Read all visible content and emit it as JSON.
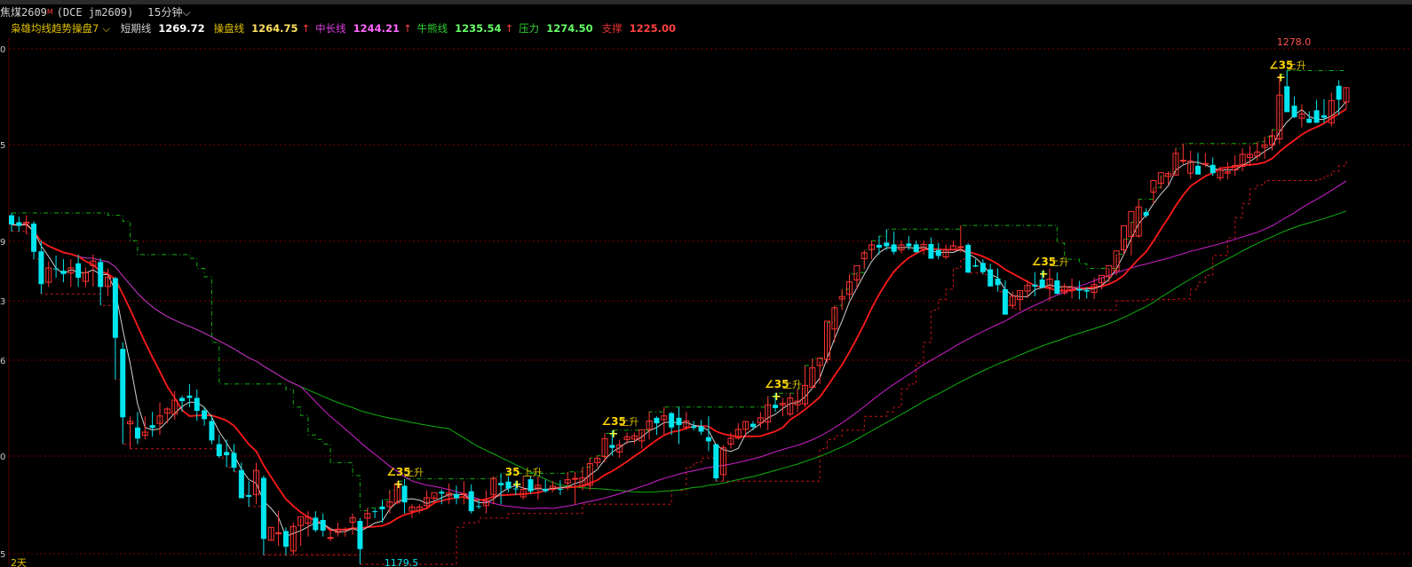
{
  "header": {
    "symbol": "焦煤2609",
    "badge": "M",
    "exchange": "(DCE  jm2609)",
    "period": "15分钟",
    "period_arrow": "⌵"
  },
  "indicator": {
    "name": "枭雄均线趋势操盘7",
    "arrow": "⌵",
    "items": [
      {
        "label": "短期线",
        "value": "1269.72",
        "label_color": "#d0d0d0",
        "value_color": "#ffffff",
        "arrow": ""
      },
      {
        "label": "操盘线",
        "value": "1264.75",
        "label_color": "#e0c000",
        "value_color": "#ffe060",
        "arrow": "↑"
      },
      {
        "label": "中长线",
        "value": "1244.21",
        "label_color": "#e040e0",
        "value_color": "#ff66ff",
        "arrow": "↑"
      },
      {
        "label": "牛熊线",
        "value": "1235.54",
        "label_color": "#30d030",
        "value_color": "#66ff66",
        "arrow": "↑"
      },
      {
        "label": "压力",
        "value": "1274.50",
        "label_color": "#30d030",
        "value_color": "#66ff66",
        "arrow": ""
      },
      {
        "label": "支撑",
        "value": "1225.00",
        "label_color": "#e03030",
        "value_color": "#ff4040",
        "arrow": ""
      }
    ]
  },
  "y_axis_labels": [
    "0",
    "5",
    "9",
    "3",
    "6",
    "0",
    "5"
  ],
  "annotations": {
    "high_value": "1278.0",
    "low_value": "1179.5",
    "bottom_left": "2天"
  },
  "signals": [
    {
      "prefix": "∠",
      "text": "35",
      "suffix": "上升"
    },
    {
      "prefix": "",
      "text": "35",
      "suffix": "上升"
    },
    {
      "prefix": "∠",
      "text": "35",
      "suffix": "上升"
    },
    {
      "prefix": "∠",
      "text": "35",
      "suffix": "上升"
    },
    {
      "prefix": "∠",
      "text": "35",
      "suffix": "上升"
    },
    {
      "prefix": "∠",
      "text": "35",
      "suffix": "上升"
    }
  ],
  "colors": {
    "background": "#000000",
    "bull": "#ff3232",
    "bear": "#00e5ee",
    "grid": "#7a0000",
    "short_line": "#d0d0d0",
    "trade_line": "#ff1a1a",
    "blue_line": "#1e28ff",
    "mid_line": "#d020d0",
    "bull_bear_line": "#10b010",
    "resistance": "#10b010",
    "support": "#c81414"
  },
  "chart_data": {
    "type": "candlestick",
    "price_range": [
      1172,
      1286
    ],
    "visible_levels": [
      1278.0,
      1179.5
    ],
    "ohlc_estimated": [
      [
        1247.5,
        1248,
        1244,
        1245.5
      ],
      [
        1246,
        1247.2,
        1244,
        1245.2
      ],
      [
        1245.7,
        1247.5,
        1243.5,
        1246
      ],
      [
        1245.7,
        1246.2,
        1238,
        1239.6
      ],
      [
        1239.7,
        1242,
        1230.5,
        1232.6
      ],
      [
        1233,
        1237.5,
        1232,
        1236.1
      ],
      [
        1236,
        1238.8,
        1234,
        1235.9
      ],
      [
        1235.5,
        1238,
        1233,
        1234.8
      ],
      [
        1235,
        1238,
        1232,
        1236.1
      ],
      [
        1237.1,
        1239,
        1232,
        1234
      ],
      [
        1233.2,
        1236.2,
        1232,
        1235.1
      ],
      [
        1236.6,
        1239,
        1232,
        1237.6
      ],
      [
        1237.4,
        1238.2,
        1228,
        1232
      ],
      [
        1232.1,
        1236,
        1230,
        1234.1
      ],
      [
        1233.9,
        1234.2,
        1212,
        1221
      ],
      [
        1218.6,
        1220,
        1198,
        1203.8
      ],
      [
        1202.4,
        1204,
        1197,
        1202.9
      ],
      [
        1201.6,
        1205,
        1198,
        1199.2
      ],
      [
        1199.9,
        1204,
        1199,
        1200.6
      ],
      [
        1202.1,
        1205,
        1199.6,
        1201.5
      ],
      [
        1202.5,
        1207,
        1200,
        1204.1
      ],
      [
        1204.7,
        1206,
        1202.5,
        1205.6
      ],
      [
        1204.5,
        1209.5,
        1203.3,
        1207.5
      ],
      [
        1208,
        1208.5,
        1205,
        1207.3
      ],
      [
        1208.5,
        1211,
        1206,
        1208
      ],
      [
        1208,
        1209.8,
        1203,
        1205.2
      ],
      [
        1205.3,
        1206,
        1202,
        1203.4
      ],
      [
        1203,
        1204.2,
        1198,
        1198.8
      ],
      [
        1198,
        1200,
        1195,
        1195.4
      ],
      [
        1196.3,
        1199,
        1193,
        1195.6
      ],
      [
        1196.1,
        1198,
        1192,
        1192.9
      ],
      [
        1192.4,
        1194,
        1187,
        1186.3
      ],
      [
        1187,
        1190,
        1184.5,
        1186.6
      ],
      [
        1187.1,
        1194,
        1185,
        1192.3
      ],
      [
        1190.7,
        1191.2,
        1174,
        1177.5
      ],
      [
        1177.2,
        1180,
        1177.2,
        1180
      ],
      [
        1178.7,
        1183.6,
        1176,
        1178.8
      ],
      [
        1179.2,
        1180,
        1174,
        1175.8
      ],
      [
        1174.9,
        1181,
        1174,
        1180.2
      ],
      [
        1180.4,
        1182,
        1176,
        1182.3
      ],
      [
        1180.9,
        1183.5,
        1178,
        1182.2
      ],
      [
        1182.1,
        1183.5,
        1179,
        1179.4
      ],
      [
        1181.6,
        1183,
        1178,
        1179.3
      ],
      [
        1177.8,
        1180,
        1177,
        1177.8
      ],
      [
        1178.9,
        1181,
        1178,
        1179.6
      ],
      [
        1179.5,
        1180,
        1178,
        1179.6
      ],
      [
        1181.1,
        1183,
        1178.4,
        1182.1
      ],
      [
        1181.4,
        1182,
        1172,
        1175.3
      ],
      [
        1182,
        1184.2,
        1180,
        1183
      ],
      [
        1183.5,
        1184,
        1182,
        1183.3
      ],
      [
        1184.5,
        1186,
        1181,
        1183.9
      ],
      [
        1184.5,
        1188,
        1183,
        1185.5
      ],
      [
        1185.3,
        1190,
        1185,
        1189.4
      ],
      [
        1189,
        1190.5,
        1183,
        1185.4
      ],
      [
        1183.5,
        1185,
        1182,
        1184.4
      ],
      [
        1183.6,
        1185,
        1183,
        1184.4
      ],
      [
        1184.7,
        1188,
        1184,
        1186.4
      ],
      [
        1186.3,
        1187,
        1185,
        1187.5
      ],
      [
        1187.7,
        1188.2,
        1185,
        1187.3
      ],
      [
        1186.8,
        1189.5,
        1185,
        1187.4
      ],
      [
        1187.2,
        1189,
        1185,
        1186.3
      ],
      [
        1187.2,
        1190,
        1185,
        1187.3
      ],
      [
        1187.8,
        1189.3,
        1183,
        1183.5
      ],
      [
        1184.6,
        1186,
        1184,
        1184.5
      ],
      [
        1184.7,
        1188,
        1183,
        1185.8
      ],
      [
        1187.1,
        1191,
        1185,
        1190.6
      ],
      [
        1189.6,
        1191.7,
        1185,
        1189.1
      ],
      [
        1189.9,
        1191,
        1187.6,
        1188.4
      ],
      [
        1188.4,
        1190,
        1187,
        1188.3
      ],
      [
        1186.6,
        1191,
        1186,
        1188.2
      ],
      [
        1190.4,
        1191,
        1187.3,
        1187.8
      ],
      [
        1188.5,
        1191,
        1186,
        1189.1
      ],
      [
        1188.3,
        1190.3,
        1187.5,
        1187.8
      ],
      [
        1188.2,
        1190,
        1187.6,
        1188.9
      ],
      [
        1188.3,
        1190.2,
        1187,
        1188.2
      ],
      [
        1189.6,
        1192,
        1188,
        1190.3
      ],
      [
        1190.4,
        1192,
        1185,
        1190.6
      ],
      [
        1188.9,
        1193,
        1188,
        1190.7
      ],
      [
        1189.1,
        1195,
        1188,
        1193.8
      ],
      [
        1194,
        1195.5,
        1193,
        1194.9
      ],
      [
        1195.3,
        1200.3,
        1194,
        1199.2
      ],
      [
        1197.8,
        1201,
        1195.5,
        1197.2
      ],
      [
        1196.3,
        1199,
        1195,
        1197.8
      ],
      [
        1199,
        1200.5,
        1198,
        1199.6
      ],
      [
        1199.1,
        1200.5,
        1198,
        1199.8
      ],
      [
        1198.7,
        1200.7,
        1197,
        1201.1
      ],
      [
        1201.2,
        1205,
        1199,
        1203
      ],
      [
        1203.7,
        1204,
        1200,
        1202.5
      ],
      [
        1203.3,
        1206,
        1200,
        1204.1
      ],
      [
        1204.7,
        1205,
        1200,
        1201.6
      ],
      [
        1203.7,
        1206,
        1198,
        1202.1
      ],
      [
        1201.7,
        1205,
        1201,
        1203
      ],
      [
        1201.9,
        1203,
        1201,
        1201.5
      ],
      [
        1201.9,
        1203.2,
        1200,
        1200.7
      ],
      [
        1199.5,
        1204,
        1196.5,
        1198.6
      ],
      [
        1198,
        1197.8,
        1190,
        1190.6
      ],
      [
        1191.4,
        1197.8,
        1190,
        1197.2
      ],
      [
        1198,
        1200.5,
        1197,
        1199.3
      ],
      [
        1199.3,
        1202.5,
        1199,
        1201.2
      ],
      [
        1201.2,
        1203,
        1199.8,
        1202.9
      ],
      [
        1202.4,
        1203,
        1201,
        1201.7
      ],
      [
        1202.6,
        1205,
        1201.5,
        1203.7
      ],
      [
        1202.8,
        1208.3,
        1201,
        1206.5
      ],
      [
        1206.5,
        1209,
        1205,
        1205.8
      ],
      [
        1206.5,
        1208,
        1204,
        1206.8
      ],
      [
        1204.5,
        1209,
        1204,
        1208
      ],
      [
        1206.5,
        1210,
        1205,
        1207.3
      ],
      [
        1206.7,
        1215,
        1206,
        1210.7
      ],
      [
        1210.3,
        1216.5,
        1210,
        1214.5
      ],
      [
        1215,
        1216,
        1211,
        1216.6
      ],
      [
        1216.3,
        1224.3,
        1215.5,
        1224.6
      ],
      [
        1222.9,
        1228,
        1220,
        1227.5
      ],
      [
        1229.4,
        1231.5,
        1227,
        1229.9
      ],
      [
        1230.4,
        1234.8,
        1229.3,
        1233.1
      ],
      [
        1233.5,
        1235.1,
        1231.5,
        1236.6
      ],
      [
        1238.1,
        1240,
        1236,
        1239.4
      ],
      [
        1240.1,
        1242,
        1238,
        1241.1
      ],
      [
        1241.1,
        1243,
        1239,
        1240.5
      ],
      [
        1241.6,
        1244.5,
        1240,
        1240.8
      ],
      [
        1241.2,
        1244,
        1239,
        1239.6
      ],
      [
        1240,
        1242,
        1239.3,
        1241.1
      ],
      [
        1241.4,
        1243,
        1240,
        1240.8
      ],
      [
        1241.2,
        1242,
        1240.5,
        1239.5
      ],
      [
        1240.2,
        1242,
        1239,
        1241.2
      ],
      [
        1241.3,
        1242.7,
        1239.5,
        1238.1
      ],
      [
        1240,
        1241.5,
        1238,
        1238.7
      ],
      [
        1238.5,
        1241.2,
        1238,
        1240.1
      ],
      [
        1240,
        1242,
        1240.5,
        1240.9
      ],
      [
        1240.6,
        1245.3,
        1239.5,
        1240.7
      ],
      [
        1241.1,
        1241.5,
        1235,
        1235.1
      ],
      [
        1236.7,
        1238,
        1236.3,
        1236.4
      ],
      [
        1237.2,
        1238,
        1234.7,
        1235.2
      ],
      [
        1235.8,
        1237,
        1233.5,
        1232.1
      ],
      [
        1233.8,
        1236,
        1231,
        1232.4
      ],
      [
        1231.5,
        1233.4,
        1228,
        1226
      ],
      [
        1228,
        1231,
        1227.3,
        1230
      ],
      [
        1229.3,
        1231,
        1227,
        1231.2
      ],
      [
        1231.1,
        1233.5,
        1229.6,
        1232.3
      ],
      [
        1232.5,
        1235.2,
        1230,
        1232.1
      ],
      [
        1233.6,
        1235.5,
        1232.8,
        1231.8
      ],
      [
        1232,
        1236,
        1229,
        1233.7
      ],
      [
        1233.4,
        1235.1,
        1230.5,
        1230.5
      ],
      [
        1230.7,
        1232.8,
        1230.3,
        1232.1
      ],
      [
        1231.4,
        1233.8,
        1229.5,
        1231.9
      ],
      [
        1231.6,
        1233.3,
        1229.3,
        1231.2
      ],
      [
        1231.3,
        1232,
        1229.5,
        1231
      ],
      [
        1230.8,
        1234,
        1229.4,
        1232.5
      ],
      [
        1232.9,
        1234.1,
        1231.5,
        1234.5
      ],
      [
        1234.2,
        1236,
        1233,
        1236.6
      ],
      [
        1235.5,
        1239.1,
        1234.5,
        1239.8
      ],
      [
        1240,
        1242.4,
        1239,
        1245.2
      ],
      [
        1242.9,
        1246,
        1238.8,
        1248.3
      ],
      [
        1243,
        1251,
        1242.6,
        1249.3
      ],
      [
        1248.2,
        1249,
        1247,
        1247.4
      ],
      [
        1252.5,
        1253.5,
        1250,
        1255
      ],
      [
        1254.4,
        1256,
        1253.2,
        1256.7
      ],
      [
        1255.9,
        1257,
        1254.1,
        1256.5
      ],
      [
        1256.2,
        1262,
        1256.3,
        1260.9
      ],
      [
        1259.4,
        1263,
        1258.5,
        1259.4
      ],
      [
        1256.6,
        1261.5,
        1255.4,
        1259.2
      ],
      [
        1258.2,
        1261,
        1256.4,
        1256.3
      ],
      [
        1258.5,
        1261,
        1258,
        1258.7
      ],
      [
        1258.4,
        1260,
        1256,
        1256.6
      ],
      [
        1255.6,
        1258,
        1255,
        1257.3
      ],
      [
        1256.6,
        1259,
        1255.3,
        1256.9
      ],
      [
        1257.3,
        1260.5,
        1256,
        1258.3
      ],
      [
        1258.1,
        1262,
        1257,
        1260.7
      ],
      [
        1260,
        1262.5,
        1258.2,
        1260.7
      ],
      [
        1260.3,
        1263.4,
        1259.2,
        1261.2
      ],
      [
        1262.2,
        1264.5,
        1259.7,
        1262.7
      ],
      [
        1262.7,
        1266,
        1261.5,
        1264.7
      ],
      [
        1264,
        1278,
        1263,
        1273.5
      ],
      [
        1275.4,
        1278.8,
        1271.2,
        1269.8
      ],
      [
        1271.2,
        1273.2,
        1268.5,
        1268.7
      ],
      [
        1268.5,
        1271.5,
        1266.5,
        1269.4
      ],
      [
        1268.4,
        1270,
        1267.4,
        1267.5
      ],
      [
        1270.2,
        1272.5,
        1269,
        1267.5
      ],
      [
        1269.1,
        1272.6,
        1267.5,
        1268.6
      ],
      [
        1267.5,
        1274,
        1266.7,
        1272.3
      ],
      [
        1275.5,
        1276.7,
        1269.2,
        1272.5
      ],
      [
        1272,
        1275,
        1270.5,
        1275.1
      ]
    ]
  }
}
